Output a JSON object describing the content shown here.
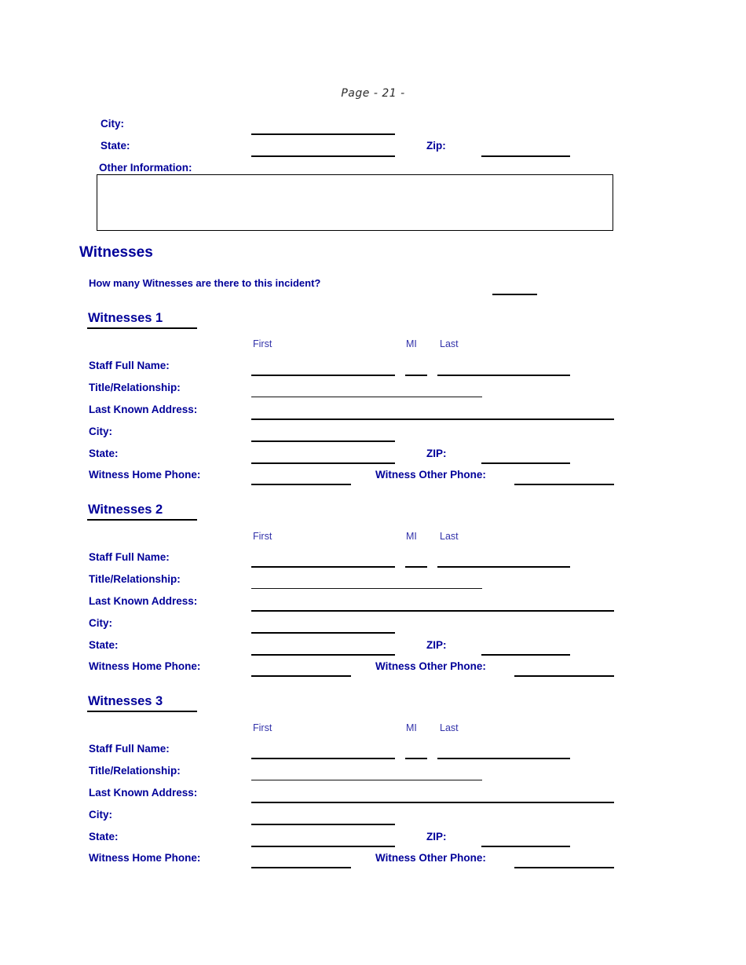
{
  "page": {
    "number_label": "Page  - 21 -"
  },
  "top_block": {
    "city_label": "City:",
    "state_label": "State:",
    "zip_label": "Zip:",
    "other_info_label": "Other Information:"
  },
  "witnesses_section": {
    "title": "Witnesses",
    "count_question": "How many Witnesses are there to this incident?"
  },
  "column_headers": {
    "first": "First",
    "mi": "MI",
    "last": "Last"
  },
  "field_labels": {
    "staff_full_name": "Staff Full Name:",
    "title_relationship": "Title/Relationship:",
    "last_known_address": "Last Known Address:",
    "city": "City:",
    "state": "State:",
    "zip": "ZIP:",
    "witness_home_phone": "Witness Home Phone:",
    "witness_other_phone": "Witness Other Phone:"
  },
  "witness_blocks": [
    {
      "title": "Witnesses 1"
    },
    {
      "title": "Witnesses 2"
    },
    {
      "title": "Witnesses 3"
    }
  ],
  "colors": {
    "label_blue": "#000099",
    "column_header_blue": "#3333aa",
    "rule_black": "#000000",
    "page_number_gray": "#2b2b2b"
  }
}
